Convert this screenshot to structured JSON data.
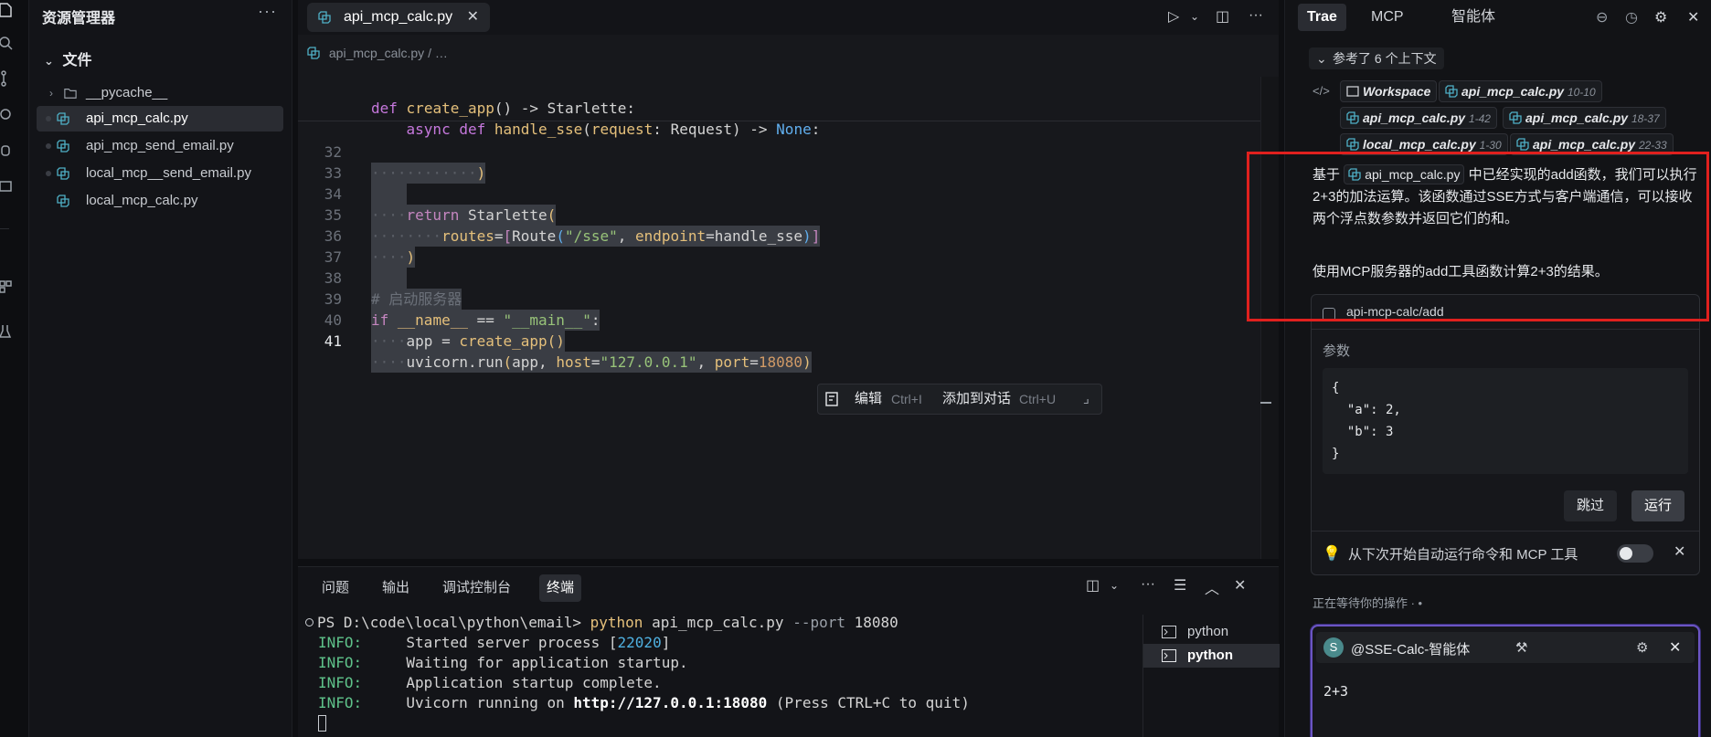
{
  "explorer": {
    "title": "资源管理器",
    "more": "···",
    "section_label": "文件",
    "items": [
      {
        "label": "__pycache__",
        "kind": "folder",
        "selected": false
      },
      {
        "label": "api_mcp_calc.py",
        "kind": "python",
        "selected": true
      },
      {
        "label": "api_mcp_send_email.py",
        "kind": "python",
        "selected": false
      },
      {
        "label": "local_mcp__send_email.py",
        "kind": "python",
        "selected": false
      },
      {
        "label": "local_mcp_calc.py",
        "kind": "python",
        "selected": false
      }
    ]
  },
  "editor": {
    "tab_label": "api_mcp_calc.py",
    "tab_close": "✕",
    "breadcrumb_file": "api_mcp_calc.py",
    "breadcrumb_sep": "/ …",
    "sticky": {
      "line1": "def create_app() -> Starlette:",
      "line2": "    async def handle_sse(request: Request) -> None:"
    },
    "current_line": 41
  },
  "inline_actions": {
    "edit": "编辑",
    "edit_key": "Ctrl+I",
    "add": "添加到对话",
    "add_key": "Ctrl+U"
  },
  "panel": {
    "tabs": [
      "问题",
      "输出",
      "调试控制台",
      "终端"
    ],
    "active_tab": "终端",
    "terminal": {
      "prompt": "PS D:\\code\\local\\python\\email>",
      "command": "python",
      "args": "api_mcp_calc.py",
      "flag": "--port",
      "port": "18080",
      "lines": [
        {
          "level": "INFO:",
          "text_before": "     Started server process [",
          "pid": "22020",
          "text_after": "]"
        },
        {
          "level": "INFO:",
          "text": "     Waiting for application startup."
        },
        {
          "level": "INFO:",
          "text": "     Application startup complete."
        },
        {
          "level": "INFO:",
          "text_before": "     Uvicorn running on ",
          "url": "http://127.0.0.1:18080",
          "text_after": " (Press CTRL+C to quit)"
        }
      ]
    },
    "terminal_list": [
      "python",
      "python"
    ]
  },
  "ai": {
    "tabs": [
      "Trae",
      "MCP",
      "智能体"
    ],
    "active_tab": "Trae",
    "context_header": "参考了 6 个上下文",
    "chips": [
      {
        "label": "Workspace",
        "range": ""
      },
      {
        "label": "api_mcp_calc.py",
        "range": "10-10"
      },
      {
        "label": "api_mcp_calc.py",
        "range": "1-42"
      },
      {
        "label": "api_mcp_calc.py",
        "range": "18-37"
      },
      {
        "label": "local_mcp_calc.py",
        "range": "1-30"
      },
      {
        "label": "api_mcp_calc.py",
        "range": "22-33"
      }
    ],
    "para1_prefix": "基于",
    "para1_file": "api_mcp_calc.py",
    "para1_rest": "中已经实现的add函数，我们可以执行2+3的加法运算。该函数通过SSE方式与客户端通信，可以接收两个浮点数参数并返回它们的和。",
    "para2": "使用MCP服务器的add工具函数计算2+3的结果。",
    "tool": {
      "name": "api-mcp-calc/add",
      "params_label": "参数",
      "params": "{\n  \"a\": 2,\n  \"b\": 3\n}",
      "skip": "跳过",
      "run": "运行",
      "auto_run": "从下次开始自动运行命令和 MCP 工具",
      "auto_run_enabled": false
    },
    "waiting": "正在等待你的操作 · •",
    "chat": {
      "avatar": "S",
      "agent": "@SSE-Calc-智能体",
      "input": "2+3"
    }
  },
  "colors": {
    "highlight_box": "#e0201e",
    "chat_border": "#6b55c4",
    "info_green": "#5fc28a"
  }
}
